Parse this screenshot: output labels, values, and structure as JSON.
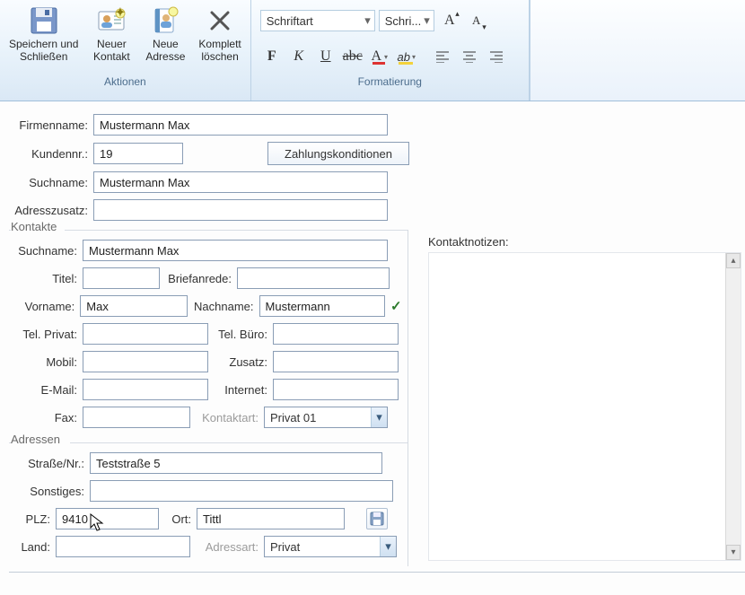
{
  "ribbon": {
    "aktionen_label": "Aktionen",
    "formatierung_label": "Formatierung",
    "save_close": "Speichern und\nSchließen",
    "neuer_kontakt": "Neuer\nKontakt",
    "neue_adresse": "Neue\nAdresse",
    "komplett_loeschen": "Komplett\nlöschen"
  },
  "formatting": {
    "font_placeholder": "Schriftart",
    "size_placeholder": "Schri..."
  },
  "firma": {
    "firmenname_label": "Firmenname:",
    "firmenname": "Mustermann Max",
    "kundennr_label": "Kundennr.:",
    "kundennr": "19",
    "zahlung_btn": "Zahlungskonditionen",
    "suchname_label": "Suchname:",
    "suchname": "Mustermann Max",
    "adresszusatz_label": "Adresszusatz:",
    "adresszusatz": ""
  },
  "kontakte": {
    "title": "Kontakte",
    "suchname_label": "Suchname:",
    "suchname": "Mustermann Max",
    "titel_label": "Titel:",
    "titel": "",
    "briefanrede_label": "Briefanrede:",
    "briefanrede": "",
    "vorname_label": "Vorname:",
    "vorname": "Max",
    "nachname_label": "Nachname:",
    "nachname": "Mustermann",
    "telprivat_label": "Tel. Privat:",
    "telprivat": "",
    "telbuero_label": "Tel. Büro:",
    "telbuero": "",
    "mobil_label": "Mobil:",
    "mobil": "",
    "zusatz_label": "Zusatz:",
    "zusatz": "",
    "email_label": "E-Mail:",
    "email": "",
    "internet_label": "Internet:",
    "internet": "",
    "fax_label": "Fax:",
    "fax": "",
    "kontaktart_label": "Kontaktart:",
    "kontaktart": "Privat 01"
  },
  "kontaktnotizen": {
    "label": "Kontaktnotizen:"
  },
  "adressen": {
    "title": "Adressen",
    "strasse_label": "Straße/Nr.:",
    "strasse": "Teststraße 5",
    "sonstiges_label": "Sonstiges:",
    "sonstiges": "",
    "plz_label": "PLZ:",
    "plz": "9410",
    "ort_label": "Ort:",
    "ort": "Tittl",
    "land_label": "Land:",
    "land": "",
    "adressart_label": "Adressart:",
    "adressart": "Privat"
  }
}
